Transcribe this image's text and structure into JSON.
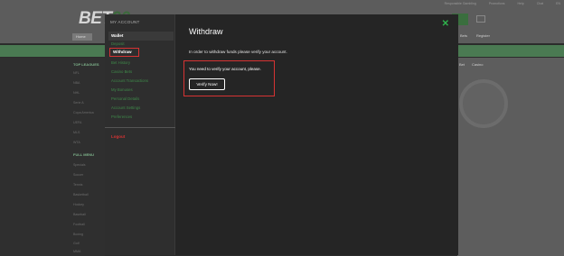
{
  "background": {
    "logo_a": "BET",
    "logo_b": "90",
    "home_label": "Home",
    "top_links": [
      "Responsible Gambling",
      "Promotions",
      "Help",
      "Chat",
      "EN"
    ],
    "right_chips": [
      "Bets",
      "Register"
    ],
    "left_sections": [
      {
        "title": "TOP LEAGUES",
        "items": [
          "NFL",
          "NBA",
          "NHL",
          "Serie A",
          "Copa America",
          "UEFA",
          "MLS",
          "WTA"
        ]
      },
      {
        "title": "FULL MENU",
        "items": [
          "Specials",
          "Soccer",
          "Tennis",
          "Basketball",
          "Hockey",
          "Baseball",
          "Football",
          "Boxing",
          "Golf",
          "MMA"
        ]
      }
    ],
    "right_tabs": [
      "Bet",
      "Casino"
    ]
  },
  "modal": {
    "account_title": "MY ACCOUNT",
    "wallet_label": "Wallet",
    "menu_items": [
      "Deposit",
      "Withdraw",
      "Bet History",
      "Casino Bets",
      "Account Transactions",
      "My Bonuses",
      "Personal Details",
      "Account Settings",
      "Preferences"
    ],
    "logout_label": "Logout",
    "title": "Withdraw",
    "close_symbol": "✕",
    "info_text": "In order to withdraw funds please verify your account.",
    "verify_message": "You need to verify your account, please.",
    "verify_button": "Verify Now!"
  },
  "colors": {
    "accent_green": "#2fb24c",
    "highlight_red": "#d63333"
  }
}
